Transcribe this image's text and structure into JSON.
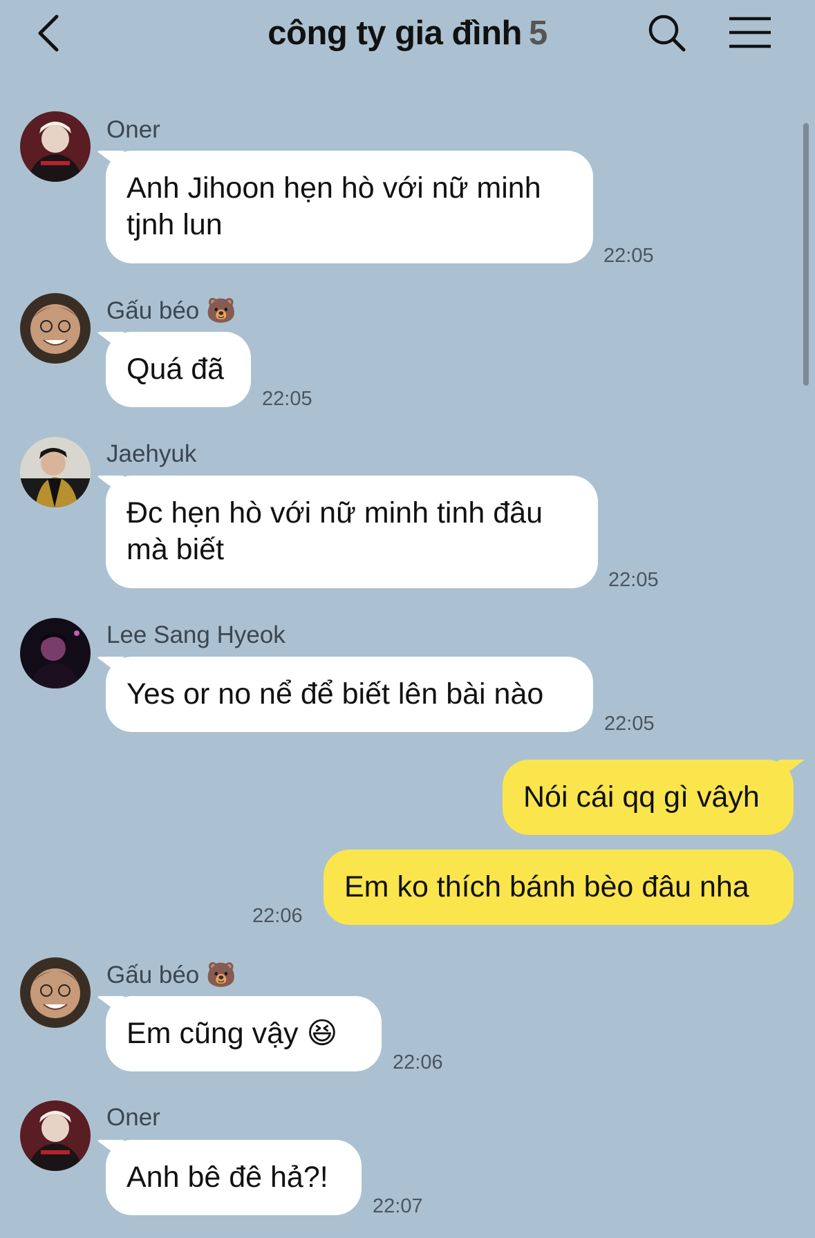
{
  "header": {
    "title": "công ty gia đình",
    "member_count": "5"
  },
  "colors": {
    "background": "#abc1d1",
    "incoming_bubble": "#ffffff",
    "outgoing_bubble": "#fae54d"
  },
  "messages": [
    {
      "sender": "Oner",
      "text_lines": [
        "Anh Jihoon hẹn hò với nữ minh",
        "tjnh lun"
      ],
      "time": "22:05"
    },
    {
      "sender": "Gấu béo 🐻",
      "text_lines": [
        "Quá đã"
      ],
      "time": "22:05"
    },
    {
      "sender": "Jaehyuk",
      "text_lines": [
        "Đc hẹn hò với nữ minh tinh đâu",
        "mà biết"
      ],
      "time": "22:05"
    },
    {
      "sender": "Lee Sang Hyeok",
      "text_lines": [
        "Yes or no nể để biết lên bài nào"
      ],
      "time": "22:05"
    },
    {
      "sender": "",
      "outgoing": true,
      "text_lines": [
        "Nói cái qq gì vâyh"
      ],
      "time": ""
    },
    {
      "sender": "",
      "outgoing": true,
      "text_lines": [
        "Em ko thích bánh bèo đâu nha"
      ],
      "time": "22:06"
    },
    {
      "sender": "Gấu béo 🐻",
      "text_lines": [
        "Em cũng vậy 😆"
      ],
      "time": "22:06"
    },
    {
      "sender": "Oner",
      "text_lines": [
        "Anh bê đê hả?!"
      ],
      "time": "22:07"
    }
  ]
}
